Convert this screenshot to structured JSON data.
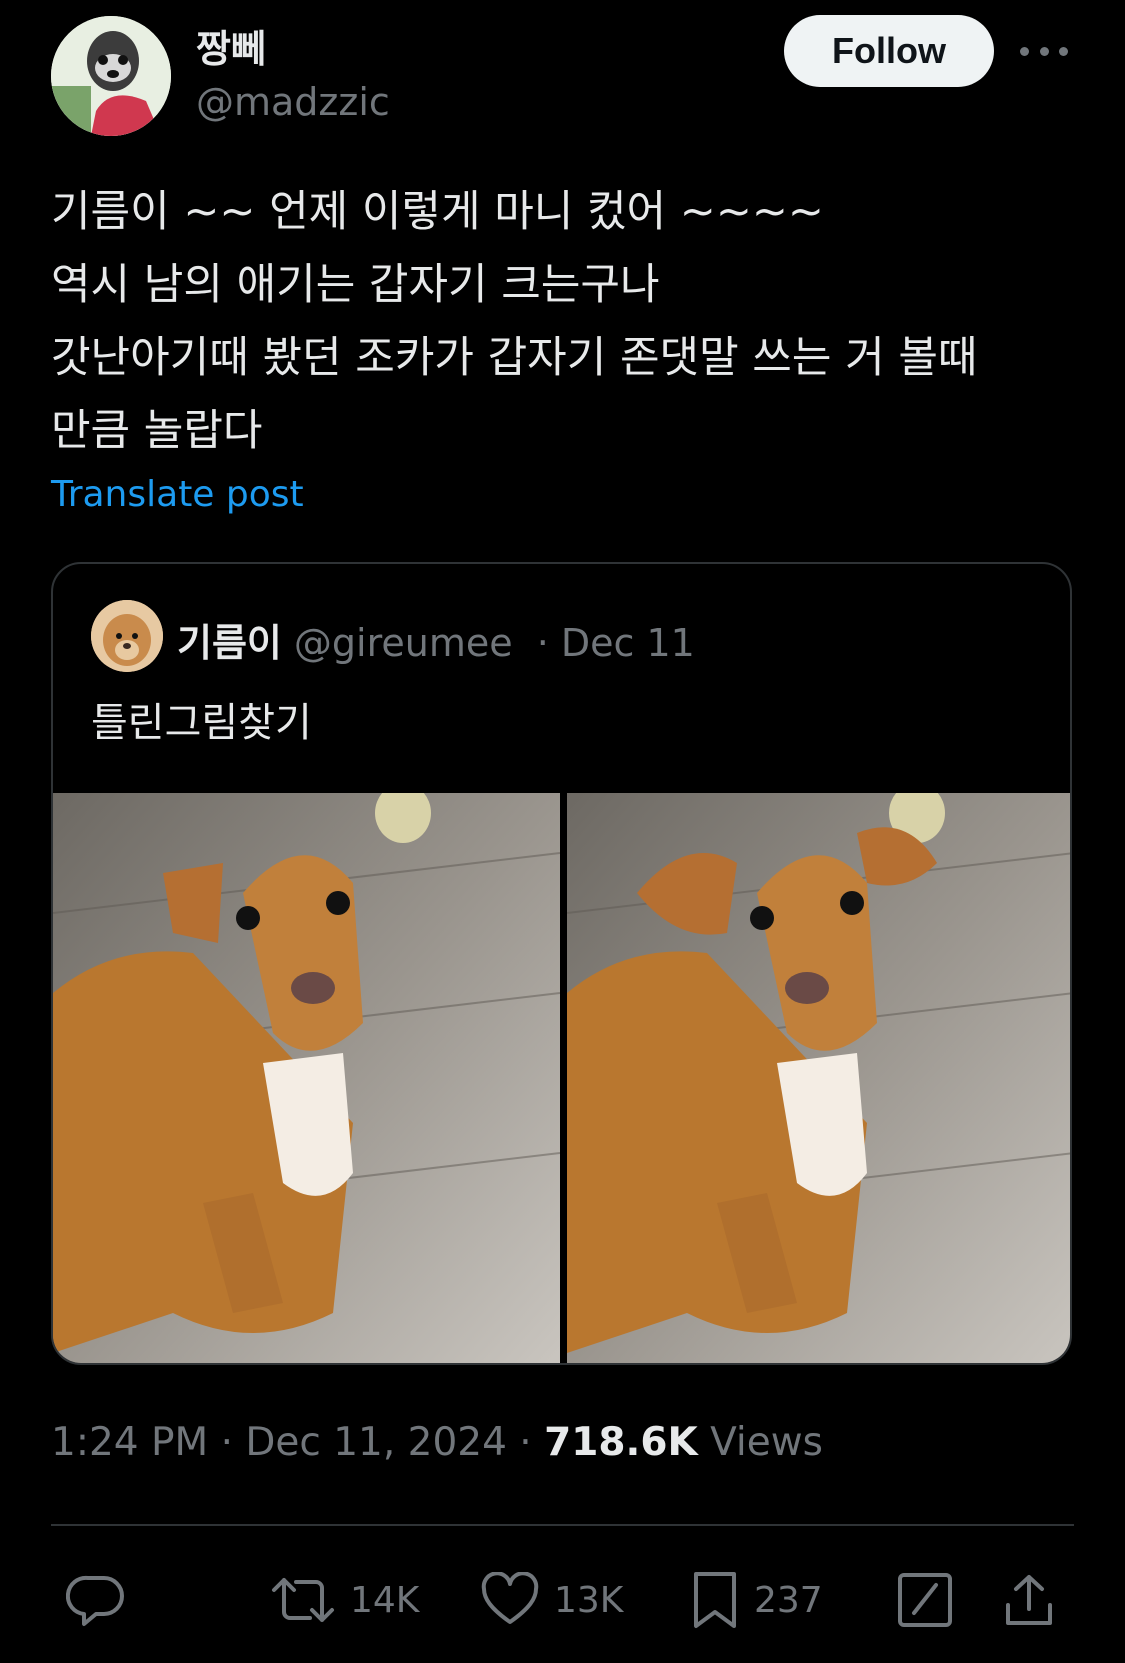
{
  "author": {
    "display_name": "짱뻬",
    "handle": "@madzzic",
    "follow_label": "Follow"
  },
  "tweet": {
    "lines": [
      "기름이 ~~ 언제 이렇게 마니 컸어 ~~~~",
      "역시 남의 애기는 갑자기 크는구나",
      "갓난아기때 봤던 조카가 갑자기 존댓말 쓰는 거 볼때",
      "만큼 놀랍다"
    ],
    "translate_label": "Translate post"
  },
  "quote": {
    "display_name": "기름이",
    "handle": "@gireumee",
    "date": "· Dec 11",
    "text": "틀린그림찾기"
  },
  "meta": {
    "time": "1:24 PM",
    "date": "· Dec 11, 2024 ·",
    "views_count": "718.6K",
    "views_label": "Views"
  },
  "actions": {
    "retweets": "14K",
    "likes": "13K",
    "bookmarks": "237"
  },
  "colors": {
    "background": "#000000",
    "text": "#e7e9ea",
    "secondary": "#71767b",
    "link": "#1d9bf0",
    "border": "#2f3336"
  }
}
